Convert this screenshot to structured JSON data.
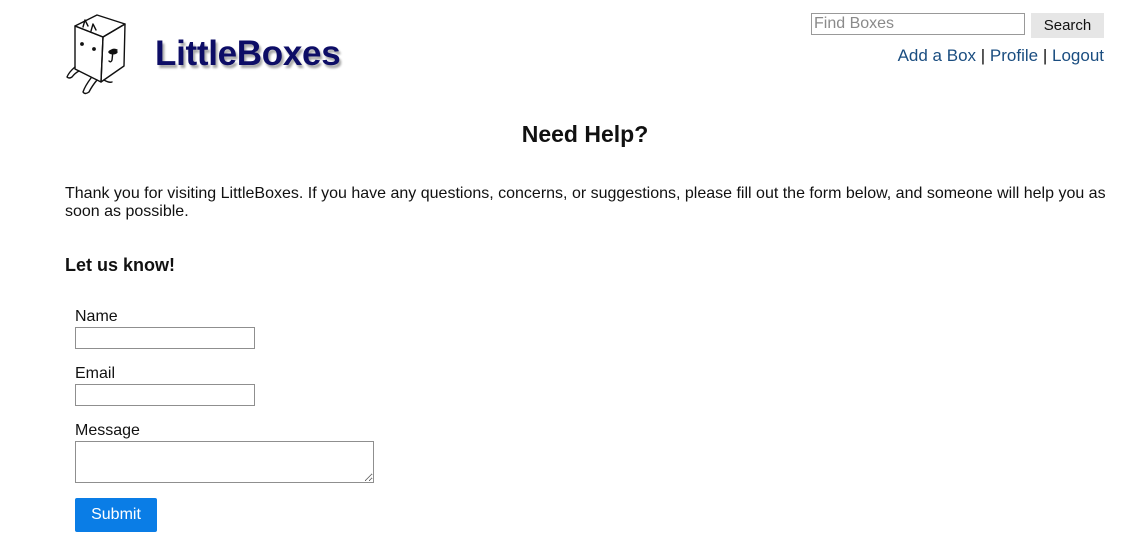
{
  "header": {
    "logo_text": "LittleBoxes",
    "search": {
      "placeholder": "Find Boxes",
      "value": "",
      "button_label": "Search"
    },
    "nav": {
      "items": [
        "Add a Box",
        "Profile",
        "Logout"
      ],
      "separator": "|"
    },
    "colors": {
      "logo_text": "#0d0d66",
      "nav_link": "#1a4d80",
      "search_button_bg": "#e6e6e6"
    }
  },
  "main": {
    "title": "Need Help?",
    "intro": "Thank you for visiting LittleBoxes. If you have any questions, concerns, or suggestions, please fill out the form below, and someone will help you as soon as possible.",
    "form": {
      "heading": "Let us know!",
      "name_label": "Name",
      "name_value": "",
      "email_label": "Email",
      "email_value": "",
      "message_label": "Message",
      "message_value": "",
      "submit_label": "Submit",
      "submit_color": "#0a7de6"
    }
  }
}
